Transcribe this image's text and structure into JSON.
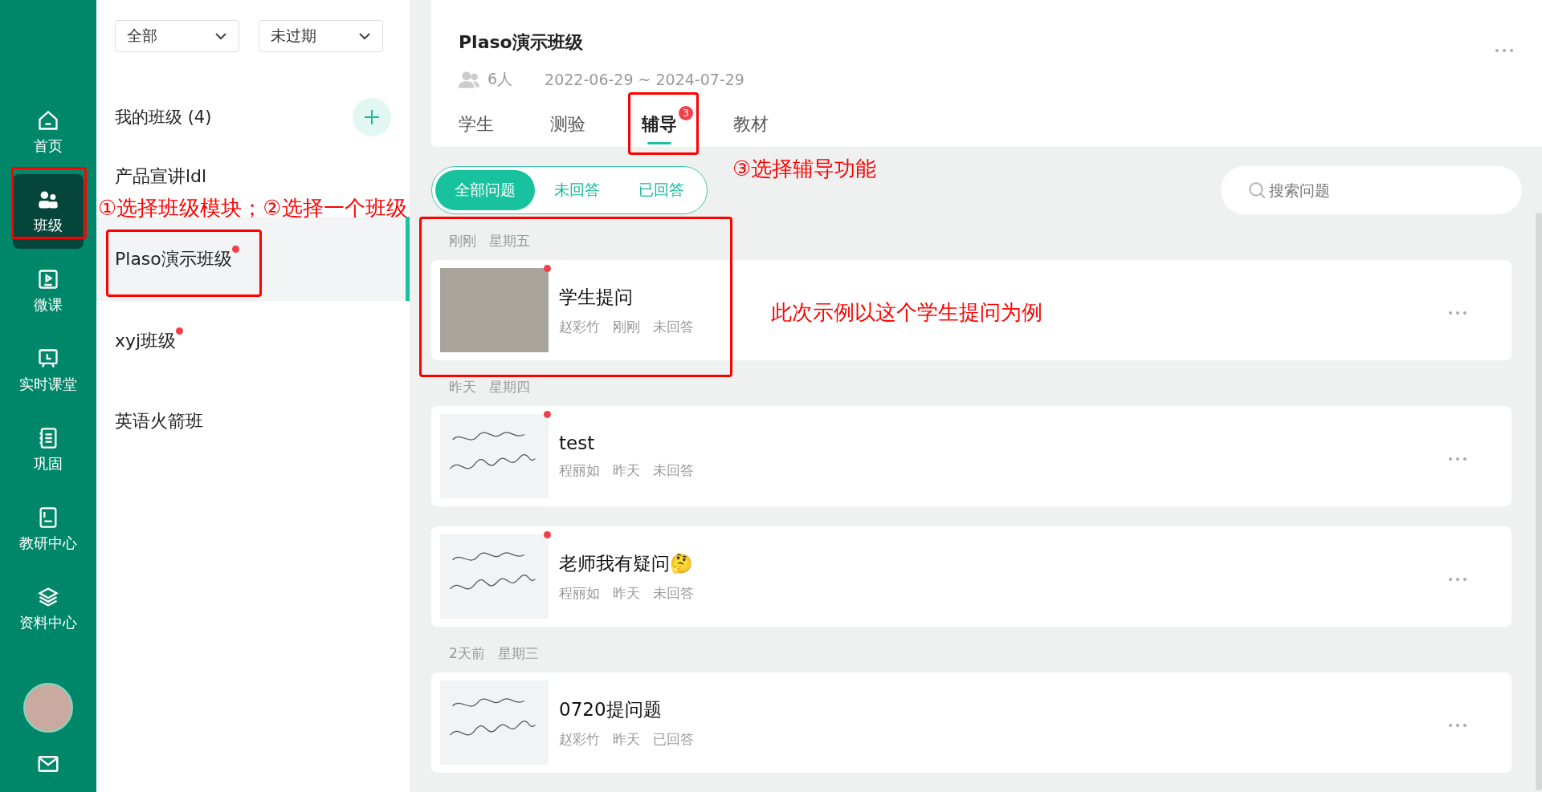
{
  "nav": [
    {
      "label": "首页",
      "selected": false
    },
    {
      "label": "班级",
      "selected": true
    },
    {
      "label": "微课",
      "selected": false
    },
    {
      "label": "实时课堂",
      "selected": false
    },
    {
      "label": "巩固",
      "selected": false
    },
    {
      "label": "教研中心",
      "selected": false
    },
    {
      "label": "资料中心",
      "selected": false
    }
  ],
  "class_panel": {
    "filters": [
      "全部",
      "未过期"
    ],
    "title": "我的班级 (4)",
    "classes": [
      {
        "name": "产品宣讲ldl",
        "unread": false,
        "selected": false
      },
      {
        "name": "Plaso演示班级",
        "unread": true,
        "selected": true
      },
      {
        "name": "xyj班级",
        "unread": true,
        "selected": false
      },
      {
        "name": "英语火箭班",
        "unread": false,
        "selected": false
      }
    ]
  },
  "header": {
    "title": "Plaso演示班级",
    "members": "6人",
    "dates": "2022-06-29 ~ 2024-07-29",
    "tabs": [
      {
        "label": "学生",
        "selected": false
      },
      {
        "label": "测验",
        "selected": false
      },
      {
        "label": "辅导",
        "selected": true,
        "badge": "3"
      },
      {
        "label": "教材",
        "selected": false
      }
    ]
  },
  "filters": [
    {
      "label": "全部问题",
      "selected": true
    },
    {
      "label": "未回答",
      "selected": false
    },
    {
      "label": "已回答",
      "selected": false
    }
  ],
  "search": {
    "placeholder": "搜索问题"
  },
  "questions": [
    {
      "group": [
        "刚刚",
        "星期五"
      ],
      "title": "学生提问",
      "author": "赵彩竹",
      "time": "刚刚",
      "status": "未回答",
      "unread": true,
      "kind": "photo"
    },
    {
      "group": [
        "昨天",
        "星期四"
      ],
      "title": "test",
      "author": "程丽如",
      "time": "昨天",
      "status": "未回答",
      "unread": true,
      "kind": "handwriting"
    },
    {
      "title": "老师我有疑问🤔",
      "author": "程丽如",
      "time": "昨天",
      "status": "未回答",
      "unread": true,
      "kind": "handwriting"
    },
    {
      "group": [
        "2天前",
        "星期三"
      ],
      "title": "0720提问题",
      "author": "赵彩竹",
      "time": "昨天",
      "status": "已回答",
      "unread": false,
      "kind": "handwriting"
    }
  ],
  "annotations": [
    "①选择班级模块；②选择一个班级",
    "③选择辅导功能",
    "此次示例以这个学生提问为例"
  ]
}
